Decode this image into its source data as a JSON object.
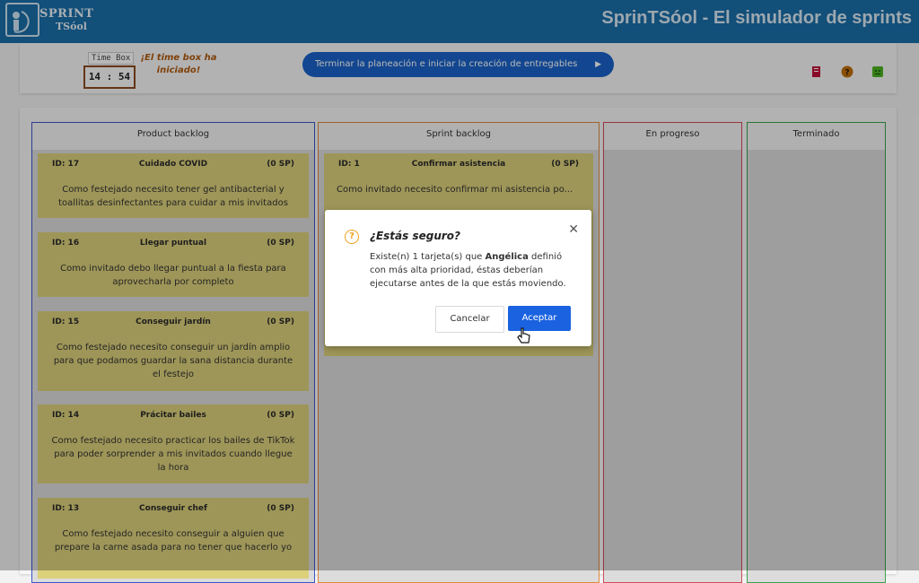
{
  "header": {
    "logo": {
      "line1": "SPRINT",
      "line2": "TSóol"
    },
    "title": "SprinTSóol - El simulador de sprints"
  },
  "timebox": {
    "label": "Time Box",
    "value": "14 : 54",
    "message": "¡El time box ha iniciado!"
  },
  "toolbar": {
    "start_button": "Terminar la planeación e iniciar la creación de entregables",
    "icons": [
      "document-icon",
      "help-icon",
      "user-icon"
    ],
    "colors": {
      "document": "#c0103a",
      "help": "#c0700a",
      "user": "#4ab320"
    }
  },
  "columns": [
    {
      "title": "Product backlog",
      "color": "#3b55c8"
    },
    {
      "title": "Sprint backlog",
      "color": "#e08a3c"
    },
    {
      "title": "En progreso",
      "color": "#d24a5a"
    },
    {
      "title": "Terminado",
      "color": "#3aa14a"
    }
  ],
  "product_backlog": [
    {
      "id": "ID: 17",
      "title": "Cuidado COVID",
      "sp": "(0 SP)",
      "desc": "Como festejado necesito tener gel antibacterial y toallitas desinfectantes para cuidar a mis invitados"
    },
    {
      "id": "ID: 16",
      "title": "Llegar puntual",
      "sp": "(0 SP)",
      "desc": "Como invitado debo llegar puntual a la fiesta para aprovecharla por completo"
    },
    {
      "id": "ID: 15",
      "title": "Conseguir jardín",
      "sp": "(0 SP)",
      "desc": "Como festejado necesito conseguir un jardín amplio para que podamos guardar la sana distancia durante el festejo"
    },
    {
      "id": "ID: 14",
      "title": "Prácitar bailes",
      "sp": "(0 SP)",
      "desc": "Como festejado necesito practicar los bailes de TikTok para poder sorprender a mis invitados cuando llegue la hora"
    },
    {
      "id": "ID: 13",
      "title": "Conseguir chef",
      "sp": "(0 SP)",
      "desc": "Como festejado necesito conseguir a alguien que prepare la carne asada para no tener que hacerlo yo"
    }
  ],
  "sprint_backlog": [
    {
      "id": "ID: 1",
      "title": "Confirmar asistencia",
      "sp": "(0 SP)",
      "desc": "Como invitado necesito confirmar mi asistencia po..."
    }
  ],
  "modal": {
    "title": "¿Estás seguro?",
    "text_pre": "Existe(n) 1 tarjeta(s) que ",
    "text_bold": "Angélica",
    "text_post": " definió con más alta prioridad, éstas deberían ejecutarse antes de la que estás moviendo.",
    "cancel": "Cancelar",
    "accept": "Aceptar",
    "icon": "warning-question-icon"
  }
}
